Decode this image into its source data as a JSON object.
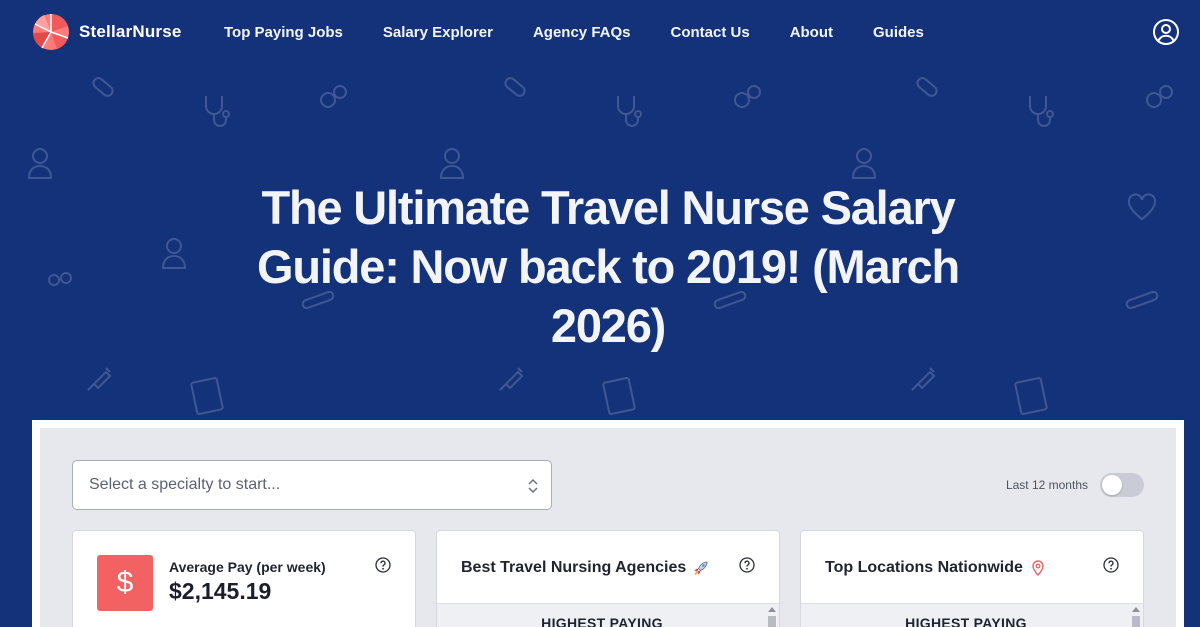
{
  "brand": {
    "name": "StellarNurse",
    "logo_colors": [
      "#ff7a7a",
      "#f15a5a",
      "#ffffff"
    ]
  },
  "nav": {
    "items": [
      {
        "label": "Top Paying Jobs"
      },
      {
        "label": "Salary Explorer"
      },
      {
        "label": "Agency FAQs"
      },
      {
        "label": "Contact Us"
      },
      {
        "label": "About"
      },
      {
        "label": "Guides"
      }
    ],
    "account_icon": "user-circle-icon"
  },
  "hero": {
    "title": "The Ultimate Travel Nurse Salary Guide: Now back to 2019! (March 2026)"
  },
  "filters": {
    "specialty_placeholder": "Select a specialty to start...",
    "toggle_label": "Last 12 months",
    "toggle_on": false
  },
  "cards": {
    "average_pay": {
      "label": "Average Pay (per week)",
      "value": "$2,145.19",
      "icon": "dollar-icon",
      "accent": "#f26262"
    },
    "agencies": {
      "title": "Best Travel Nursing Agencies",
      "emoji": "rocket-icon",
      "subhead": "HIGHEST PAYING"
    },
    "locations": {
      "title": "Top Locations Nationwide",
      "emoji": "map-pin-icon",
      "subhead": "HIGHEST PAYING"
    }
  },
  "colors": {
    "background": "#14327a",
    "panel": "#e7e8ee",
    "accent": "#f26262"
  }
}
